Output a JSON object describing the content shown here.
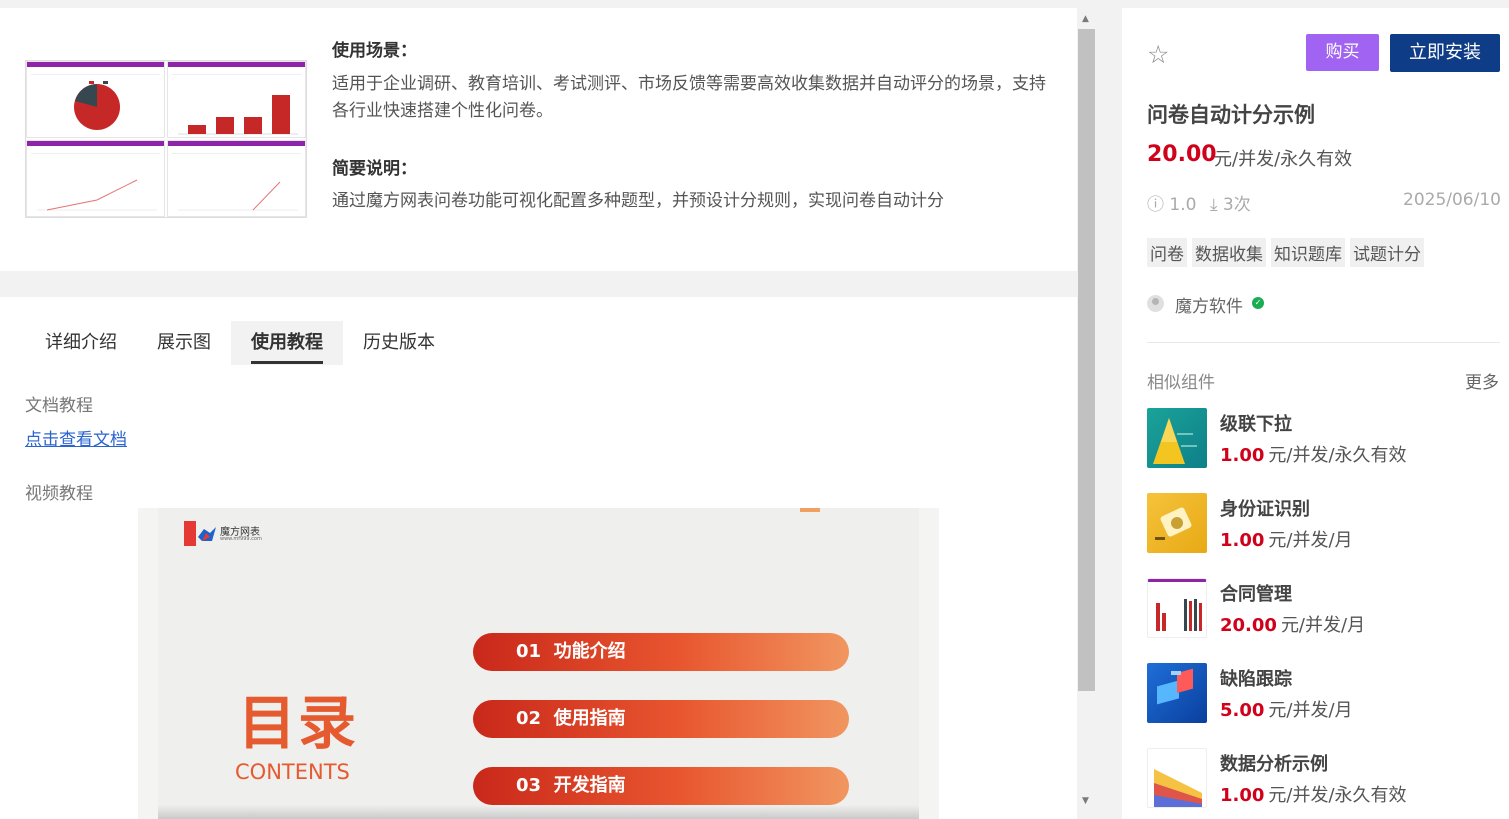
{
  "intro": {
    "scene_heading": "使用场景：",
    "scene_text": "适用于企业调研、教育培训、考试测评、市场反馈等需要高效收集数据并自动评分的场景，支持各行业快速搭建个性化问卷。",
    "summary_heading": "简要说明：",
    "summary_text": "通过魔方网表问卷功能可视化配置多种题型，并预设计分规则，实现问卷自动计分"
  },
  "tabs": [
    {
      "label": "详细介绍",
      "active": false
    },
    {
      "label": "展示图",
      "active": false
    },
    {
      "label": "使用教程",
      "active": true
    },
    {
      "label": "历史版本",
      "active": false
    }
  ],
  "tutorial": {
    "doc_label": "文档教程",
    "doc_link": "点击查看文档",
    "video_label": "视频教程"
  },
  "video": {
    "logo_text": "魔方网表",
    "logo_url": "www.mf999.com",
    "title": "目录",
    "subtitle": "CONTENTS",
    "items": [
      {
        "num": "01",
        "text": "功能介绍"
      },
      {
        "num": "02",
        "text": "使用指南"
      },
      {
        "num": "03",
        "text": "开发指南"
      }
    ]
  },
  "product": {
    "buy_label": "购买",
    "install_label": "立即安装",
    "title": "问卷自动计分示例",
    "price": "20.00",
    "price_unit": "元/并发/永久有效",
    "version": "1.0",
    "downloads": "3次",
    "date": "2025/06/10",
    "tags": [
      "问卷",
      "数据收集",
      "知识题库",
      "试题计分"
    ],
    "author": "魔方软件"
  },
  "similar": {
    "heading": "相似组件",
    "more_label": "更多",
    "items": [
      {
        "name": "级联下拉",
        "price": "1.00",
        "unit": "元/并发/永久有效"
      },
      {
        "name": "身份证识别",
        "price": "1.00",
        "unit": "元/并发/月"
      },
      {
        "name": "合同管理",
        "price": "20.00",
        "unit": "元/并发/月"
      },
      {
        "name": "缺陷跟踪",
        "price": "5.00",
        "unit": "元/并发/月"
      },
      {
        "name": "数据分析示例",
        "price": "1.00",
        "unit": "元/并发/永久有效"
      }
    ]
  },
  "colors": {
    "accent_buy": "#a164f2",
    "accent_install": "#0f3c86",
    "price_red": "#d0021b",
    "link_blue": "#2b64d1"
  }
}
